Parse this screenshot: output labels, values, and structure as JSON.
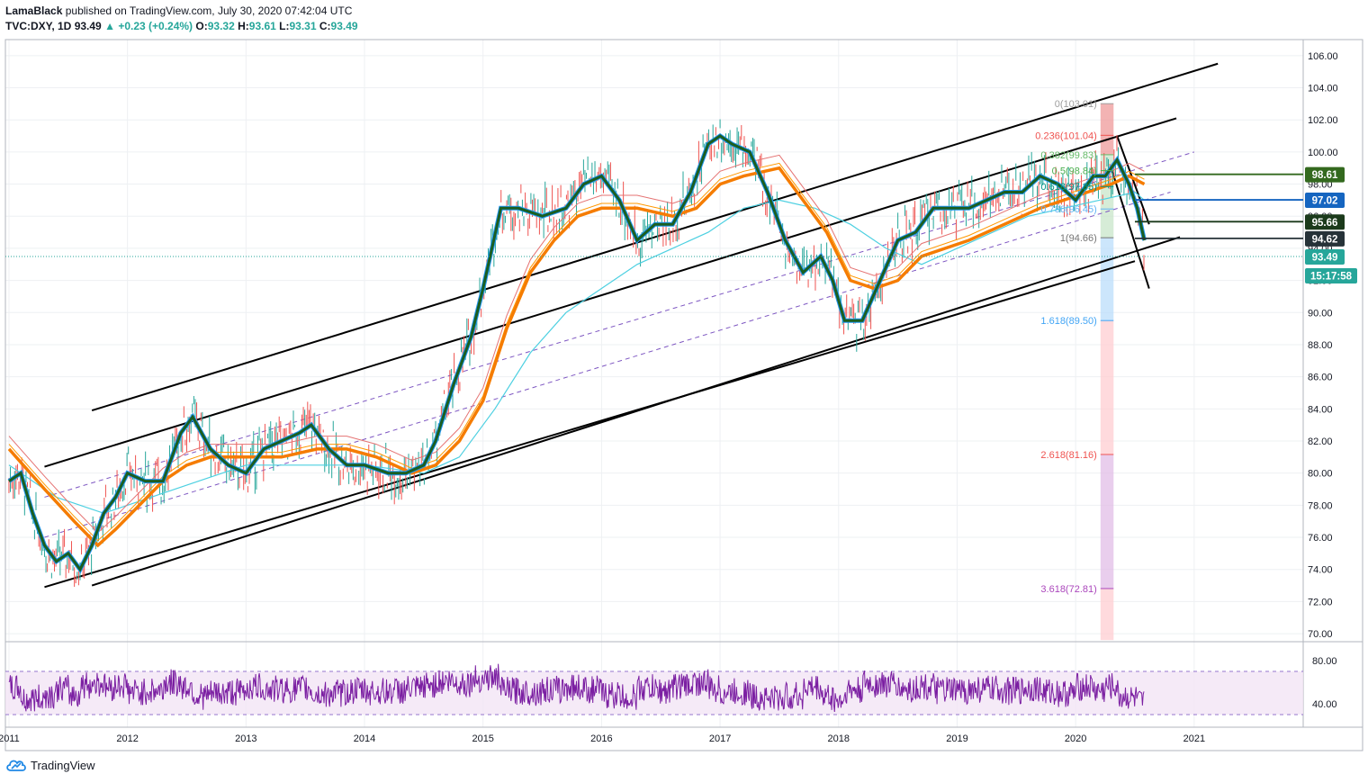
{
  "header": {
    "publisher": "LamaBlack",
    "published_text": "published on TradingView.com, July 30, 2020 07:42:04 UTC",
    "symbol": "TVC:DXY, 1D",
    "last": "93.49",
    "change_arrow": "▲",
    "change": "+0.23 (+0.24%)",
    "o_label": "O:",
    "o": "93.32",
    "h_label": "H:",
    "h": "93.61",
    "l_label": "L:",
    "l": "93.31",
    "c_label": "C:",
    "c": "93.49"
  },
  "footer": {
    "brand": "TradingView",
    "icon": "tradingview-cloud-icon"
  },
  "colors": {
    "candle_up": "#26a69a",
    "candle_down": "#ef5350",
    "ma_fast": "#1b5e20",
    "ma_blue": "#2196f3",
    "ma_orange": "#f57c00",
    "ma_orange_thin": "#ff9800",
    "ma_red_thin": "#e57373",
    "ma_cyan": "#4dd0e1",
    "rsi": "#7b1fa2",
    "rsi_band": "#f3e5f5"
  },
  "chart_data": {
    "type": "line",
    "title": "TVC:DXY, 1D",
    "x_ticks": [
      "2011",
      "2012",
      "2013",
      "2014",
      "2015",
      "2016",
      "2017",
      "2018",
      "2019",
      "2020",
      "2021"
    ],
    "y_ticks": [
      "106.00",
      "104.00",
      "102.00",
      "100.00",
      "98.00",
      "96.00",
      "94.00",
      "92.00",
      "90.00",
      "88.00",
      "86.00",
      "84.00",
      "82.00",
      "80.00",
      "78.00",
      "76.00",
      "74.00",
      "72.00",
      "70.00"
    ],
    "ylim": [
      69.5,
      107
    ],
    "xlim": [
      2010.97,
      2021.92
    ],
    "series": [
      {
        "values": [
          [
            2011.0,
            79.5
          ],
          [
            2011.1,
            80.0
          ],
          [
            2011.2,
            77.5
          ],
          [
            2011.3,
            75.5
          ],
          [
            2011.4,
            74.5
          ],
          [
            2011.5,
            75.0
          ],
          [
            2011.6,
            74.0
          ],
          [
            2011.7,
            75.5
          ],
          [
            2011.8,
            77.5
          ],
          [
            2011.9,
            78.5
          ],
          [
            2012.0,
            80.0
          ],
          [
            2012.15,
            79.5
          ],
          [
            2012.3,
            79.5
          ],
          [
            2012.45,
            82.5
          ],
          [
            2012.55,
            83.5
          ],
          [
            2012.7,
            81.5
          ],
          [
            2012.85,
            80.5
          ],
          [
            2013.0,
            80.0
          ],
          [
            2013.15,
            81.5
          ],
          [
            2013.3,
            82.0
          ],
          [
            2013.45,
            82.5
          ],
          [
            2013.55,
            83.0
          ],
          [
            2013.7,
            81.5
          ],
          [
            2013.85,
            80.5
          ],
          [
            2014.0,
            80.5
          ],
          [
            2014.2,
            80.0
          ],
          [
            2014.35,
            80.0
          ],
          [
            2014.5,
            80.5
          ],
          [
            2014.6,
            82.0
          ],
          [
            2014.75,
            85.5
          ],
          [
            2014.9,
            88.5
          ],
          [
            2015.0,
            91.5
          ],
          [
            2015.15,
            96.5
          ],
          [
            2015.3,
            96.5
          ],
          [
            2015.5,
            96.0
          ],
          [
            2015.7,
            96.5
          ],
          [
            2015.85,
            98.0
          ],
          [
            2016.0,
            98.5
          ],
          [
            2016.15,
            97.0
          ],
          [
            2016.3,
            94.5
          ],
          [
            2016.45,
            95.5
          ],
          [
            2016.6,
            95.5
          ],
          [
            2016.75,
            97.5
          ],
          [
            2016.9,
            100.5
          ],
          [
            2017.0,
            101.0
          ],
          [
            2017.1,
            100.5
          ],
          [
            2017.25,
            100.0
          ],
          [
            2017.4,
            97.5
          ],
          [
            2017.55,
            94.5
          ],
          [
            2017.7,
            92.5
          ],
          [
            2017.85,
            93.5
          ],
          [
            2017.95,
            92.0
          ],
          [
            2018.05,
            89.5
          ],
          [
            2018.2,
            89.5
          ],
          [
            2018.35,
            92.0
          ],
          [
            2018.5,
            94.5
          ],
          [
            2018.65,
            95.0
          ],
          [
            2018.8,
            96.5
          ],
          [
            2018.95,
            96.5
          ],
          [
            2019.1,
            96.5
          ],
          [
            2019.25,
            97.0
          ],
          [
            2019.4,
            97.5
          ],
          [
            2019.55,
            97.5
          ],
          [
            2019.7,
            98.5
          ],
          [
            2019.85,
            98.0
          ],
          [
            2020.0,
            97.0
          ],
          [
            2020.15,
            98.5
          ],
          [
            2020.25,
            98.5
          ],
          [
            2020.35,
            99.5
          ],
          [
            2020.45,
            98.0
          ],
          [
            2020.52,
            96.5
          ],
          [
            2020.58,
            94.5
          ]
        ]
      },
      {
        "values": [
          [
            2011.0,
            81.5
          ],
          [
            2011.3,
            79.0
          ],
          [
            2011.55,
            77.0
          ],
          [
            2011.75,
            75.5
          ],
          [
            2011.9,
            76.5
          ],
          [
            2012.1,
            78.0
          ],
          [
            2012.3,
            79.5
          ],
          [
            2012.5,
            80.5
          ],
          [
            2012.7,
            81.0
          ],
          [
            2013.0,
            81.0
          ],
          [
            2013.3,
            81.0
          ],
          [
            2013.6,
            81.5
          ],
          [
            2013.85,
            81.5
          ],
          [
            2014.1,
            81.0
          ],
          [
            2014.4,
            80.0
          ],
          [
            2014.6,
            80.5
          ],
          [
            2014.8,
            82.0
          ],
          [
            2015.0,
            84.5
          ],
          [
            2015.2,
            89.0
          ],
          [
            2015.4,
            92.5
          ],
          [
            2015.6,
            94.5
          ],
          [
            2015.8,
            96.0
          ],
          [
            2016.0,
            96.5
          ],
          [
            2016.3,
            96.5
          ],
          [
            2016.6,
            96.0
          ],
          [
            2016.8,
            96.5
          ],
          [
            2017.0,
            98.0
          ],
          [
            2017.2,
            98.5
          ],
          [
            2017.5,
            99.0
          ],
          [
            2017.7,
            97.0
          ],
          [
            2017.9,
            95.0
          ],
          [
            2018.1,
            92.0
          ],
          [
            2018.3,
            91.5
          ],
          [
            2018.5,
            92.0
          ],
          [
            2018.7,
            93.5
          ],
          [
            2018.9,
            94.0
          ],
          [
            2019.1,
            94.5
          ],
          [
            2019.4,
            95.5
          ],
          [
            2019.7,
            96.5
          ],
          [
            2019.9,
            97.0
          ],
          [
            2020.1,
            97.5
          ],
          [
            2020.3,
            98.0
          ],
          [
            2020.45,
            98.5
          ],
          [
            2020.58,
            98.0
          ]
        ]
      },
      {
        "values": [
          [
            2011.0,
            80.5
          ],
          [
            2011.4,
            78.5
          ],
          [
            2011.8,
            77.5
          ],
          [
            2012.2,
            78.5
          ],
          [
            2012.6,
            79.5
          ],
          [
            2013.0,
            80.5
          ],
          [
            2013.5,
            80.5
          ],
          [
            2014.0,
            80.5
          ],
          [
            2014.5,
            80.0
          ],
          [
            2014.8,
            81.0
          ],
          [
            2015.1,
            84.0
          ],
          [
            2015.4,
            87.5
          ],
          [
            2015.7,
            90.0
          ],
          [
            2016.0,
            91.5
          ],
          [
            2016.3,
            93.0
          ],
          [
            2016.6,
            94.0
          ],
          [
            2016.9,
            95.0
          ],
          [
            2017.2,
            96.5
          ],
          [
            2017.5,
            97.0
          ],
          [
            2017.8,
            96.5
          ],
          [
            2018.1,
            95.5
          ],
          [
            2018.4,
            94.0
          ],
          [
            2018.7,
            93.0
          ],
          [
            2019.0,
            94.0
          ],
          [
            2019.3,
            95.0
          ],
          [
            2019.6,
            96.0
          ],
          [
            2019.9,
            96.5
          ],
          [
            2020.2,
            97.0
          ],
          [
            2020.5,
            97.5
          ],
          [
            2020.58,
            97.0
          ]
        ]
      }
    ],
    "rsi_axis": [
      "80.00",
      "40.00"
    ],
    "fib_levels": [
      {
        "label": "0(103.01)",
        "value": 103.01,
        "color": "#9e9e9e"
      },
      {
        "label": "0.236(101.04)",
        "value": 101.04,
        "color": "#ef5350"
      },
      {
        "label": "0.382(99.83)",
        "value": 99.83,
        "color": "#66bb6a"
      },
      {
        "label": "0.5(98.84)",
        "value": 98.84,
        "color": "#4caf50"
      },
      {
        "label": "0.618(97.85)",
        "value": 97.85,
        "color": "#009688"
      },
      {
        "label": "0.786(96.45)",
        "value": 96.45,
        "color": "#64b5f6"
      },
      {
        "label": "1(94.66)",
        "value": 94.66,
        "color": "#757575"
      },
      {
        "label": "1.618(89.50)",
        "value": 89.5,
        "color": "#42a5f5"
      },
      {
        "label": "2.618(81.16)",
        "value": 81.16,
        "color": "#ef5350"
      },
      {
        "label": "3.618(72.81)",
        "value": 72.81,
        "color": "#ab47bc"
      }
    ],
    "price_tags": [
      {
        "text": "98.61",
        "value": 98.61,
        "bg": "#33691e"
      },
      {
        "text": "97.02",
        "value": 97.02,
        "bg": "#1565c0"
      },
      {
        "text": "95.66",
        "value": 95.66,
        "bg": "#1b3a1b"
      },
      {
        "text": "94.62",
        "value": 94.62,
        "bg": "#263238"
      },
      {
        "text": "93.49",
        "value": 93.49,
        "bg": "#26a69a"
      }
    ],
    "countdown": "15:17:58"
  }
}
